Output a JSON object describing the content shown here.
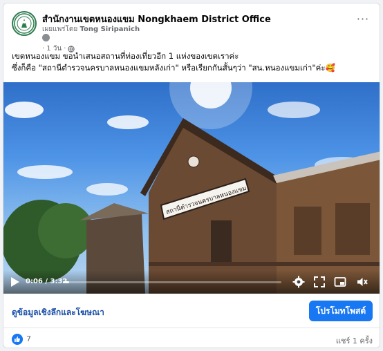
{
  "post": {
    "page_name": "สำนักงานเขตหนองแขม Nongkhaem District Office",
    "byline_prefix": "เผยแพร่โดย",
    "author": "Tong Siripanich",
    "time": "1 วัน",
    "more_label": "···",
    "caption_line1": "เขตหนองแขม ขอนำเสนอสถานที่ท่องเที่ยวอีก 1 แห่งของเขตเราค่ะ",
    "caption_line2": "ซึ่งก็คือ \"สถานีตำรวจนครบาลหนองแขมหลังเก่า\" หรือเรียกกันสั้นๆว่า \"สน.หนองแขมเก่า\"ค่ะ🥰",
    "sign_text": "สถานีตำรวจนครบาลหนองแขม"
  },
  "video": {
    "current_time": "0:06",
    "duration": "3:32",
    "progress": 0.028
  },
  "actions": {
    "insights_link": "ดูข้อมูลเชิงลึกและโฆษณา",
    "promote_button": "โปรโมทโพสต์"
  },
  "stats": {
    "like_count": "7",
    "shares": "แชร์ 1 ครั้ง"
  },
  "colors": {
    "brand_blue": "#1877f2",
    "link_blue": "#1b4fa8",
    "muted_text": "#65676b"
  },
  "icons": [
    "district-logo-icon",
    "globe-icon",
    "play-icon",
    "settings-icon",
    "expand-icon",
    "pip-icon",
    "volume-icon",
    "like-icon",
    "more-icon"
  ]
}
